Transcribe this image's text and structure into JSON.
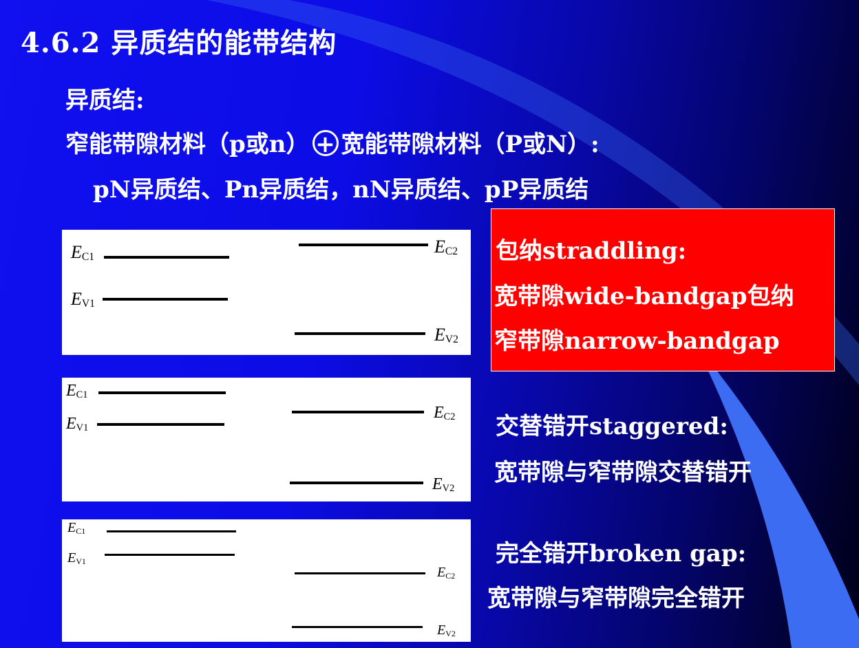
{
  "title": "4.6.2 异质结的能带结构",
  "heading": "异质结:",
  "line2": {
    "part1": "窄能带隙材料（p或n）",
    "plus": "+",
    "part2": "宽能带隙材料（P或N）:"
  },
  "line3": "pN异质结、Pn异质结，nN异质结、pP异质结",
  "diagrams": [
    {
      "ec1": {
        "e": "E",
        "sub": "C1"
      },
      "ev1": {
        "e": "E",
        "sub": "V1"
      },
      "ec2": {
        "e": "E",
        "sub": "C2"
      },
      "ev2": {
        "e": "E",
        "sub": "V2"
      }
    },
    {
      "ec1": {
        "e": "E",
        "sub": "C1"
      },
      "ev1": {
        "e": "E",
        "sub": "V1"
      },
      "ec2": {
        "e": "E",
        "sub": "C2"
      },
      "ev2": {
        "e": "E",
        "sub": "V2"
      }
    },
    {
      "ec1": {
        "e": "E",
        "sub": "C1"
      },
      "ev1": {
        "e": "E",
        "sub": "V1"
      },
      "ec2": {
        "e": "E",
        "sub": "C2"
      },
      "ev2": {
        "e": "E",
        "sub": "V2"
      }
    }
  ],
  "straddling": {
    "l1": "包纳straddling:",
    "l2": "宽带隙wide-bandgap包纳",
    "l3": "窄带隙narrow-bandgap"
  },
  "staggered": {
    "l1": "交替错开staggered:",
    "l2": "宽带隙与窄带隙交替错开"
  },
  "broken": {
    "l1": "完全错开broken gap:",
    "l2": "宽带隙与窄带隙完全错开"
  },
  "colors": {
    "background": "#1010f0",
    "highlight_box": "#ff0000",
    "text": "#ffffff",
    "band_line": "#000000"
  }
}
